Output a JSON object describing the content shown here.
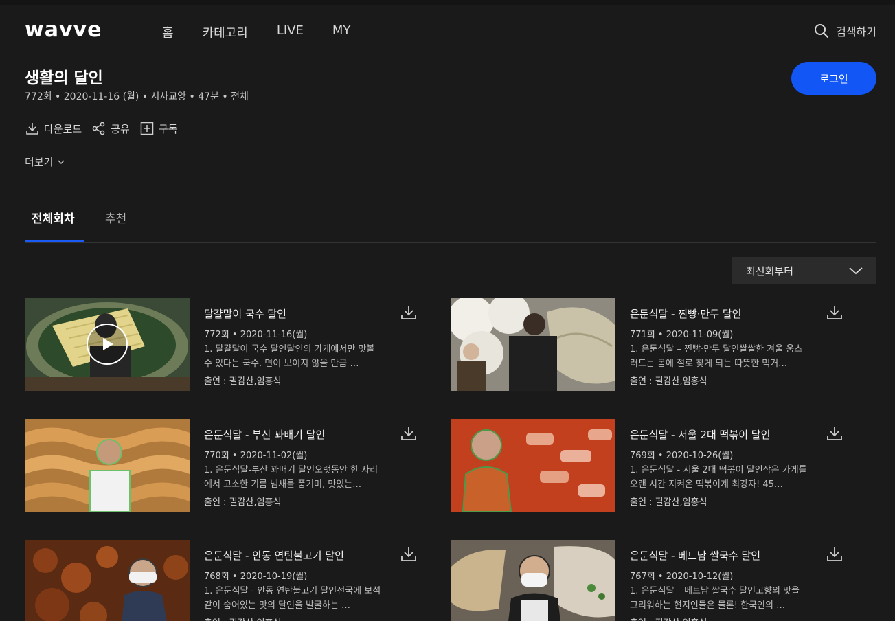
{
  "header": {
    "logo": "wavve",
    "nav": [
      "홈",
      "카테고리",
      "LIVE",
      "MY"
    ],
    "search_label": "검색하기"
  },
  "program": {
    "title": "생활의 달인",
    "meta": "772회 • 2020-11-16 (월) • 시사교양 • 47분 • 전체",
    "login_label": "로그인",
    "actions": {
      "download": "다운로드",
      "share": "공유",
      "subscribe": "구독"
    },
    "more_label": "더보기"
  },
  "tabs": {
    "all": "전체회차",
    "recommend": "추천"
  },
  "sort": {
    "selected": "최신회부터"
  },
  "episodes": [
    {
      "title": "달걀말이 국수 달인",
      "date": "772회 • 2020-11-16(월)",
      "desc": "1. 달걀말이 국수 달인달인의 가게에서만 맛볼 수 있다는 국수. 면이 보이지 않을 만큼 …",
      "cast": "출연 : 필감산,임홍식"
    },
    {
      "title": "은둔식달 - 찐빵·만두 달인",
      "date": "771회 • 2020-11-09(월)",
      "desc": "1. 은둔식달 – 찐빵·만두 달인쌀쌀한 겨울 움츠러드는 몸에 절로 찾게 되는 따뜻한 먹거…",
      "cast": "출연 : 필감산,임홍식"
    },
    {
      "title": "은둔식달 - 부산 꽈배기 달인",
      "date": "770회 • 2020-11-02(월)",
      "desc": "1. 은둔식달-부산 꽈배기 달인오랫동안 한 자리에서 고소한 기름 냄새를 풍기며, 맛있는…",
      "cast": "출연 : 필감산,임홍식"
    },
    {
      "title": "은둔식달 - 서울 2대 떡볶이 달인",
      "date": "769회 • 2020-10-26(월)",
      "desc": "1. 은둔식달 - 서울 2대 떡볶이 달인작은 가게를 오랜 시간 지켜온 떡볶이계 최강자! 45…",
      "cast": "출연 : 필감산,임홍식"
    },
    {
      "title": "은둔식달 - 안동 연탄불고기 달인",
      "date": "768회 • 2020-10-19(월)",
      "desc": "1. 은둔식달 - 안동 연탄불고기 달인전국에 보석같이 숨어있는 맛의 달인을 발굴하는 …",
      "cast": "출연 : 필감산,임홍식"
    },
    {
      "title": "은둔식달 - 베트남 쌀국수 달인",
      "date": "767회 • 2020-10-12(월)",
      "desc": "1. 은둔식달 – 베트남 쌀국수 달인고향의 맛을 그리워하는 현지인들은 물론! 한국인의 …",
      "cast": "출연 : 필감산,임홍식"
    }
  ],
  "colors": {
    "background": "#1a1a1a",
    "accent": "#1256f5"
  }
}
